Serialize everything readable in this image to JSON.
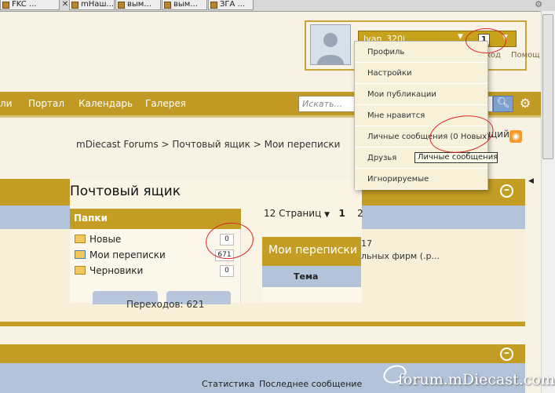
{
  "browser": {
    "tabs": [
      "FKC ...",
      "mНаш...",
      "вым...",
      "вым...",
      "ЗГА ..."
    ]
  },
  "user_panel": {
    "username": "Ivan_320i",
    "notification_count": "1",
    "exit_label": "ход",
    "help_label": "Помощ"
  },
  "nav": {
    "items": [
      "ли",
      "Портал",
      "Календарь",
      "Галерея"
    ],
    "search_placeholder": "Искать..."
  },
  "breadcrumb": {
    "items": [
      "mDiecast Forums",
      "> Почтовый ящик",
      "> Мои переписки"
    ],
    "cut_text": "щий"
  },
  "user_menu": {
    "items": [
      "Профиль",
      "Настройки",
      "Мои публикации",
      "Мне нравится",
      "Личные сообщения (0 Новых)",
      "Друзья",
      "Игнорируемые"
    ],
    "tooltip": "Личные сообщения"
  },
  "mailbox": {
    "title": "Почтовый ящик",
    "folders_header": "Папки",
    "folders": [
      {
        "name": "Новые",
        "count": "0"
      },
      {
        "name": "Мои переписки",
        "count": "671"
      },
      {
        "name": "Черновики",
        "count": "0"
      }
    ],
    "transitions_text": "Переходов: 621",
    "pages_label": "12 Страниц",
    "page_current": "1",
    "page_next": "2"
  },
  "conversations": {
    "title": "Мои переписки",
    "column": "Тема",
    "frag_1": "17",
    "frag_2": "льных фирм (.р..."
  },
  "footer": {
    "stats": "Статистика",
    "last_post": "Последнее сообщение"
  },
  "watermark": "forum.mDiecast.com",
  "colors": {
    "gold": "#c49e24",
    "blue_band": "#b3c3d9",
    "annotation": "#dd2222"
  }
}
